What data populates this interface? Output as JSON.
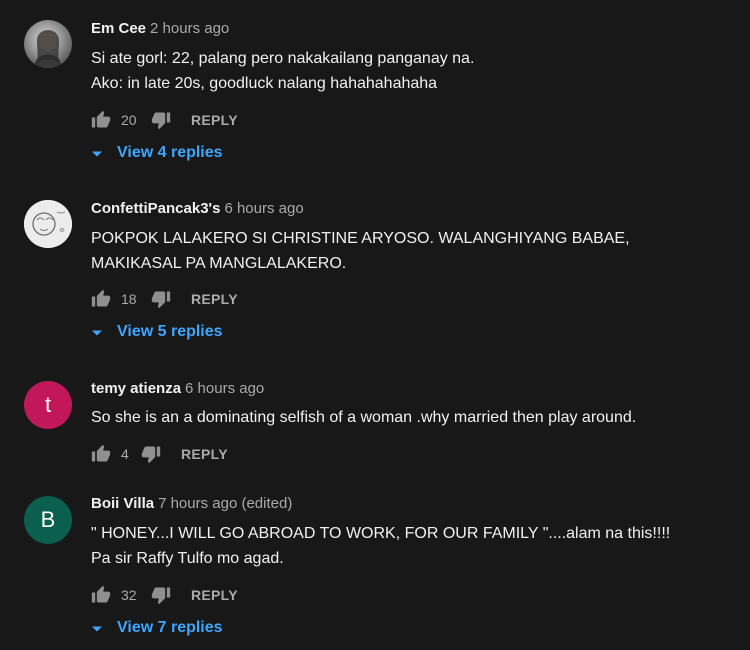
{
  "comments": [
    {
      "author": "Em Cee",
      "time": "2 hours ago",
      "lines": [
        "Si ate gorl: 22, palang pero nakakailang panganay na.",
        "Ako: in late 20s, goodluck nalang hahahahahaha"
      ],
      "likes": "20",
      "reply_label": "REPLY",
      "replies_label": "View 4 replies"
    },
    {
      "author": "ConfettiPancak3's",
      "time": "6 hours ago",
      "lines": [
        "POKPOK LALAKERO SI CHRISTINE ARYOSO. WALANGHIYANG BABAE,",
        "MAKIKASAL PA MANGLALAKERO."
      ],
      "likes": "18",
      "reply_label": "REPLY",
      "replies_label": "View 5 replies"
    },
    {
      "author": "temy atienza",
      "time": "6 hours ago",
      "avatar_letter": "t",
      "lines": [
        "So she is an a dominating selfish of a woman .why married then play around."
      ],
      "likes": "4",
      "reply_label": "REPLY"
    },
    {
      "author": "Boii Villa",
      "time": "7 hours ago (edited)",
      "avatar_letter": "B",
      "lines": [
        "\" HONEY...I WILL GO ABROAD TO WORK, FOR OUR FAMILY \"....alam na this!!!!",
        "Pa  sir Raffy Tulfo mo agad."
      ],
      "likes": "32",
      "reply_label": "REPLY",
      "replies_label": "View 7 replies"
    }
  ],
  "colors": {
    "background": "#181818",
    "link": "#3ea6ff",
    "muted": "#aaaaaa",
    "text": "#f1f1f1"
  }
}
